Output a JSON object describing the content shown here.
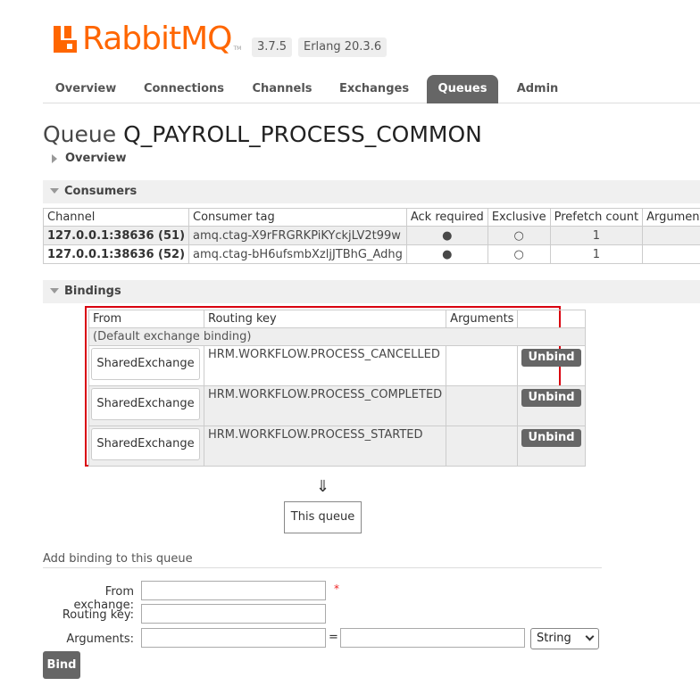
{
  "header": {
    "brand": "RabbitMQ",
    "trademark": "TM",
    "version": "3.7.5",
    "erlang": "Erlang 20.3.6",
    "brand_color": "#ff6600"
  },
  "tabs": [
    {
      "label": "Overview"
    },
    {
      "label": "Connections"
    },
    {
      "label": "Channels"
    },
    {
      "label": "Exchanges"
    },
    {
      "label": "Queues",
      "active": true
    },
    {
      "label": "Admin"
    }
  ],
  "page": {
    "title_prefix": "Queue",
    "queue_name": "Q_PAYROLL_PROCESS_COMMON",
    "overview_label": "Overview"
  },
  "consumers": {
    "section_label": "Consumers",
    "columns": [
      "Channel",
      "Consumer tag",
      "Ack required",
      "Exclusive",
      "Prefetch count",
      "Arguments"
    ],
    "rows": [
      {
        "channel": "127.0.0.1:38636 (51)",
        "tag": "amq.ctag-X9rFRGRKPiKYckjLV2t99w",
        "ack": "●",
        "exclusive": "○",
        "prefetch": "1",
        "args": ""
      },
      {
        "channel": "127.0.0.1:38636 (52)",
        "tag": "amq.ctag-bH6ufsmbXzljJTBhG_Adhg",
        "ack": "●",
        "exclusive": "○",
        "prefetch": "1",
        "args": ""
      }
    ]
  },
  "bindings": {
    "section_label": "Bindings",
    "columns": [
      "From",
      "Routing key",
      "Arguments",
      ""
    ],
    "default_binding": "(Default exchange binding)",
    "rows": [
      {
        "from": "SharedExchange",
        "routing_key": "HRM.WORKFLOW.PROCESS_CANCELLED",
        "args": "",
        "action": "Unbind"
      },
      {
        "from": "SharedExchange",
        "routing_key": "HRM.WORKFLOW.PROCESS_COMPLETED",
        "args": "",
        "action": "Unbind"
      },
      {
        "from": "SharedExchange",
        "routing_key": "HRM.WORKFLOW.PROCESS_STARTED",
        "args": "",
        "action": "Unbind"
      }
    ],
    "arrow": "⇓",
    "this_queue": "This queue",
    "highlight_color": "#d9000f"
  },
  "add_binding": {
    "title": "Add binding to this queue",
    "from_exchange_label": "From exchange:",
    "from_exchange_value": "",
    "required_mark": "*",
    "routing_key_label": "Routing key:",
    "routing_key_value": "",
    "arguments_label": "Arguments:",
    "arg_key_value": "",
    "equals": "=",
    "arg_value_value": "",
    "type_selected": "String",
    "bind_label": "Bind"
  }
}
